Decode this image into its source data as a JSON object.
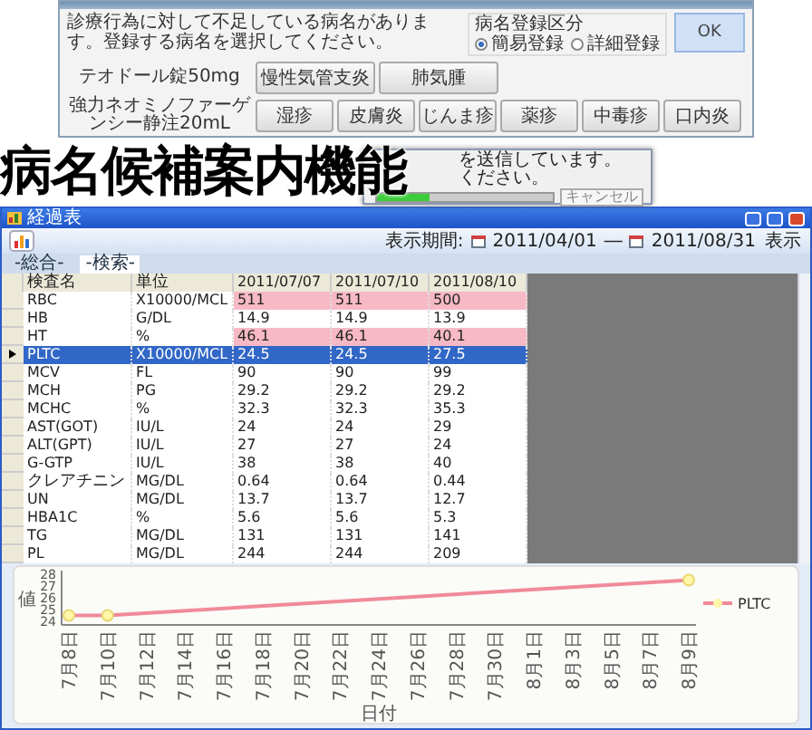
{
  "dialog": {
    "message": "診療行為に対して不足している病名があります。登録する病名を選択してください。",
    "radio_group": {
      "label": "病名登録区分",
      "options": [
        {
          "label": "簡易登録",
          "selected": true
        },
        {
          "label": "詳細登録",
          "selected": false
        }
      ]
    },
    "ok_button": "OK",
    "rows": [
      {
        "drug": "テオドール錠50mg",
        "buttons": [
          "慢性気管支炎",
          "肺気腫"
        ]
      },
      {
        "drug": "強力ネオミノファーゲンシー静注20mL",
        "buttons": [
          "湿疹",
          "皮膚炎",
          "じんま疹",
          "薬疹",
          "中毒疹",
          "口内炎"
        ]
      }
    ]
  },
  "headline": "病名候補案内機能",
  "progress_dialog": {
    "lines": [
      "を送信しています。",
      "ください。"
    ],
    "level": 0.3,
    "button": "キャンセル"
  },
  "window": {
    "title": "経過表"
  },
  "toolbar": {
    "period_label": "表示期間:",
    "from": "2011/04/01",
    "separator": "―",
    "to": "2011/08/31",
    "show_button": "表示"
  },
  "tabs": [
    {
      "label": "-総合-",
      "selected": false
    },
    {
      "label": "-検索-",
      "selected": true
    }
  ],
  "table": {
    "columns": [
      "検査名",
      "単位",
      "2011/07/07",
      "2011/07/10",
      "2011/08/10"
    ],
    "rows": [
      {
        "cells": [
          "RBC",
          "X10000/MCL",
          "511",
          "511",
          "500"
        ],
        "flagged": true,
        "selected": false
      },
      {
        "cells": [
          "HB",
          "G/DL",
          "14.9",
          "14.9",
          "13.9"
        ],
        "flagged": false,
        "selected": false
      },
      {
        "cells": [
          "HT",
          "%",
          "46.1",
          "46.1",
          "40.1"
        ],
        "flagged": true,
        "selected": false
      },
      {
        "cells": [
          "PLTC",
          "X10000/MCL",
          "24.5",
          "24.5",
          "27.5"
        ],
        "flagged": false,
        "selected": true
      },
      {
        "cells": [
          "MCV",
          "FL",
          "90",
          "90",
          "99"
        ],
        "flagged": false,
        "selected": false
      },
      {
        "cells": [
          "MCH",
          "PG",
          "29.2",
          "29.2",
          "29.2"
        ],
        "flagged": false,
        "selected": false
      },
      {
        "cells": [
          "MCHC",
          "%",
          "32.3",
          "32.3",
          "35.3"
        ],
        "flagged": false,
        "selected": false
      },
      {
        "cells": [
          "AST(GOT)",
          "IU/L",
          "24",
          "24",
          "29"
        ],
        "flagged": false,
        "selected": false
      },
      {
        "cells": [
          "ALT(GPT)",
          "IU/L",
          "27",
          "27",
          "24"
        ],
        "flagged": false,
        "selected": false
      },
      {
        "cells": [
          "G-GTP",
          "IU/L",
          "38",
          "38",
          "40"
        ],
        "flagged": false,
        "selected": false
      },
      {
        "cells": [
          "クレアチニン",
          "MG/DL",
          "0.64",
          "0.64",
          "0.44"
        ],
        "flagged": false,
        "selected": false
      },
      {
        "cells": [
          "UN",
          "MG/DL",
          "13.7",
          "13.7",
          "12.7"
        ],
        "flagged": false,
        "selected": false
      },
      {
        "cells": [
          "HBA1C",
          "%",
          "5.6",
          "5.6",
          "5.3"
        ],
        "flagged": false,
        "selected": false
      },
      {
        "cells": [
          "TG",
          "MG/DL",
          "131",
          "131",
          "141"
        ],
        "flagged": false,
        "selected": false
      },
      {
        "cells": [
          "PL",
          "MG/DL",
          "244",
          "244",
          "209"
        ],
        "flagged": false,
        "selected": false
      }
    ]
  },
  "chart": {
    "chart_data": {
      "type": "line",
      "xlabel": "日付",
      "ylabel": "値",
      "categories": [
        "7月8日",
        "7月10日",
        "7月12日",
        "7月14日",
        "7月16日",
        "7月18日",
        "7月20日",
        "7月22日",
        "7月24日",
        "7月26日",
        "7月28日",
        "7月30日",
        "8月1日",
        "8月3日",
        "8月5日",
        "8月7日",
        "8月9日"
      ],
      "series": [
        {
          "name": "PLTC",
          "color": "#f08a9a",
          "marker": "circle",
          "values": [
            24.5,
            24.5,
            null,
            null,
            null,
            null,
            null,
            null,
            null,
            null,
            null,
            null,
            null,
            null,
            null,
            null,
            27.5
          ]
        }
      ],
      "ylim": [
        24,
        28
      ],
      "yticks": [
        24,
        25,
        26,
        27,
        28
      ]
    }
  }
}
